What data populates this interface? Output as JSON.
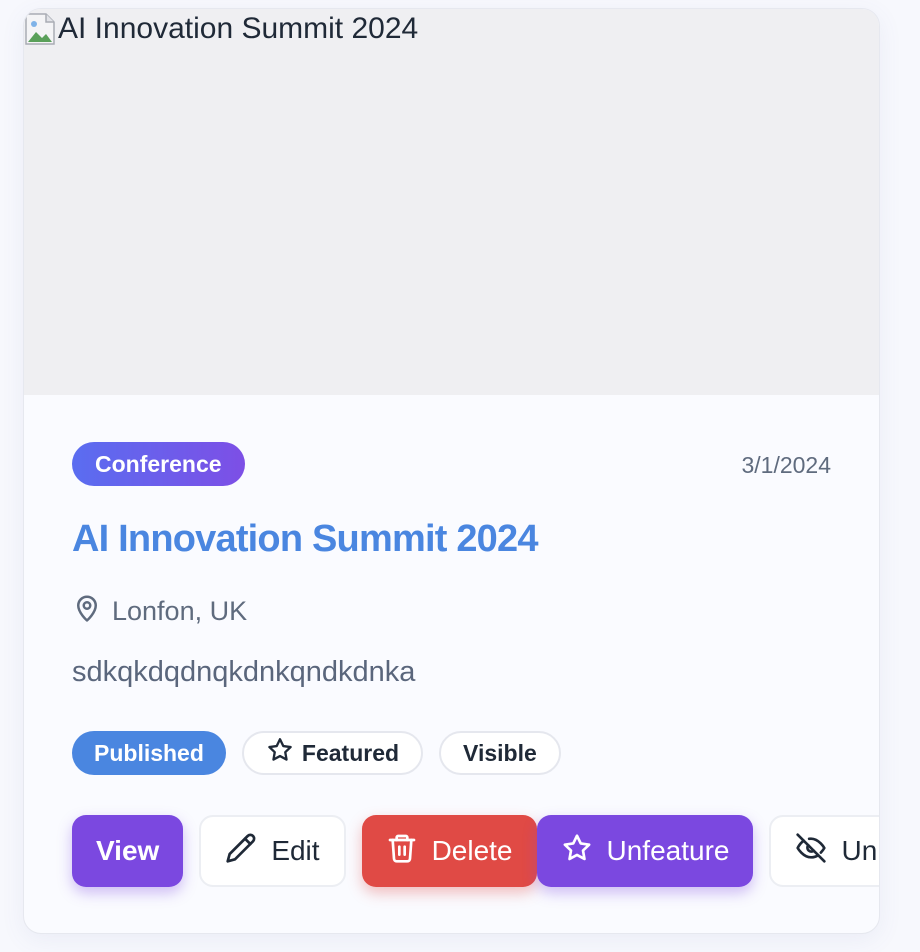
{
  "event": {
    "image_alt": "AI Innovation Summit 2024",
    "category": "Conference",
    "date": "3/1/2024",
    "title": "AI Innovation Summit 2024",
    "location": "Lonfon, UK",
    "description": "sdkqkdqdnqkdnkqndkdnka"
  },
  "badges": {
    "status": "Published",
    "featured": "Featured",
    "visibility": "Visible"
  },
  "actions": {
    "view": "View",
    "edit": "Edit",
    "delete": "Delete",
    "unfeature": "Unfeature",
    "unhide": "Unhide"
  },
  "colors": {
    "accent_purple": "#7b48e0",
    "title_blue": "#4a86e0",
    "danger_red": "#e04a45"
  },
  "icons": {
    "location": "map-pin-icon",
    "featured": "star-icon",
    "edit": "pencil-icon",
    "delete": "trash-icon",
    "unfeature": "star-icon",
    "unhide": "eye-off-icon",
    "image": "broken-image-icon"
  }
}
